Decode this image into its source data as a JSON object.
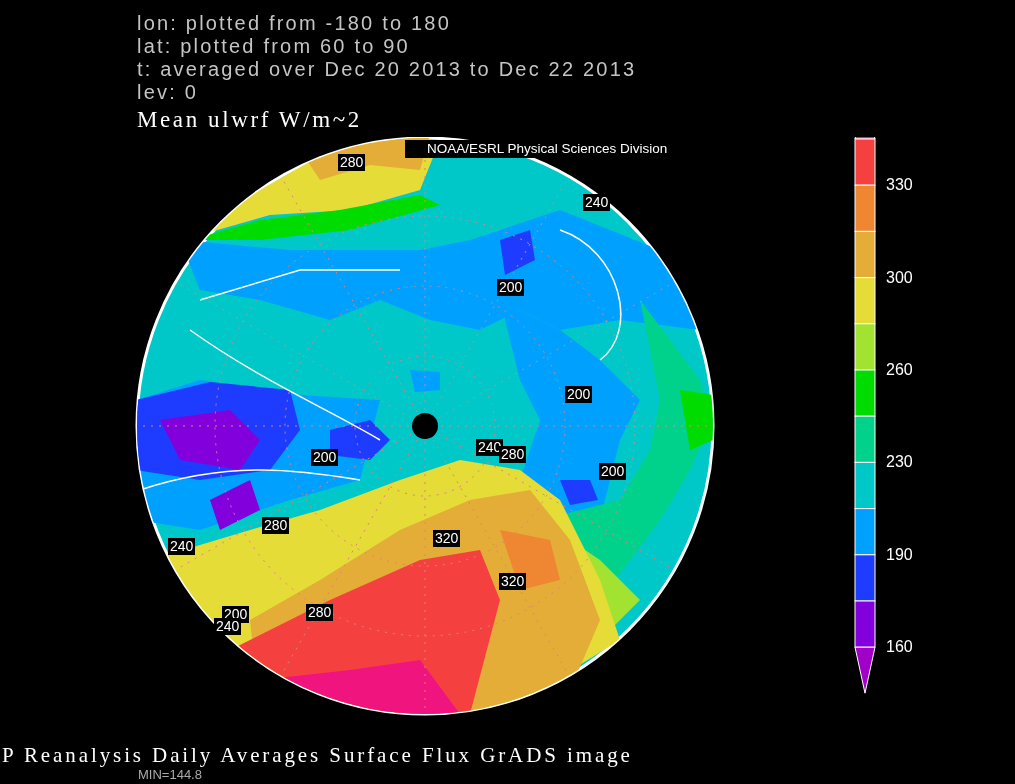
{
  "header_lines": [
    "lon: plotted from -180 to 180",
    "lat: plotted from 60 to 90",
    "t: averaged over Dec 20 2013 to Dec 22 2013",
    "lev: 0"
  ],
  "title": "Mean ulwrf W/m~2",
  "credit": "NOAA/ESRL Physical Sciences Division",
  "map": {
    "contour_labels": [
      "280",
      "240",
      "200",
      "200",
      "200",
      "240",
      "280",
      "200",
      "280",
      "240",
      "320",
      "320",
      "280",
      "200",
      "240"
    ]
  },
  "colorbar": {
    "segments": [
      {
        "kind": "arrow",
        "color": "#f0147f"
      },
      {
        "kind": "box",
        "color": "#f54040",
        "label": "330"
      },
      {
        "kind": "box",
        "color": "#ef8632"
      },
      {
        "kind": "box",
        "color": "#e4ad37",
        "label": "300"
      },
      {
        "kind": "box",
        "color": "#e5dc37"
      },
      {
        "kind": "box",
        "color": "#a2e332",
        "label": "260"
      },
      {
        "kind": "box",
        "color": "#00dc00"
      },
      {
        "kind": "box",
        "color": "#00d28c",
        "label": "230"
      },
      {
        "kind": "box",
        "color": "#00c8c8"
      },
      {
        "kind": "box",
        "color": "#00a0ff",
        "label": "190"
      },
      {
        "kind": "box",
        "color": "#1e3cff"
      },
      {
        "kind": "box",
        "color": "#8200dc",
        "label": "160"
      },
      {
        "kind": "arrow",
        "color": "#a000c8"
      }
    ]
  },
  "caption": "P Reanalysis Daily Averages Surface Flux GrADS image",
  "min_text": "MIN=144.8"
}
